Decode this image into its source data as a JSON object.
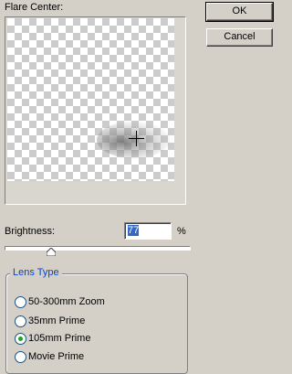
{
  "flare_center": {
    "label": "Flare Center:"
  },
  "buttons": {
    "ok": "OK",
    "cancel": "Cancel"
  },
  "brightness": {
    "label": "Brightness:",
    "value": "77",
    "unit": "%",
    "slider_fraction": 0.248
  },
  "lens_type": {
    "legend": "Lens Type",
    "options": [
      {
        "label": "50-300mm Zoom",
        "selected": false
      },
      {
        "label": "35mm Prime",
        "selected": false
      },
      {
        "label": "105mm Prime",
        "selected": true
      },
      {
        "label": "Movie Prime",
        "selected": false
      }
    ]
  },
  "colors": {
    "dialog_bg": "#d4d0c8",
    "group_title": "#0046d5",
    "radio_selected": "#21a121",
    "selection": "#316ac5"
  }
}
